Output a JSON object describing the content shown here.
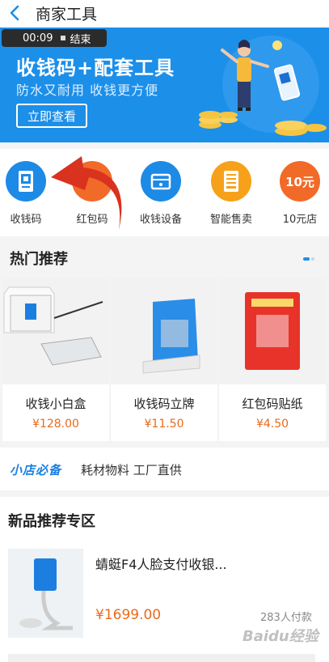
{
  "header": {
    "title": "商家工具"
  },
  "recording": {
    "time": "00:09",
    "end_label": "结束"
  },
  "banner": {
    "title": "收钱码+配套工具",
    "subtitle": "防水又耐用   收钱更方便",
    "button_label": "立即查看"
  },
  "icons": [
    {
      "label": "收钱码",
      "icon": "qr-code-icon",
      "color": "#1d8ae6"
    },
    {
      "label": "红包码",
      "icon": "red-packet-icon",
      "color": "#f26a28"
    },
    {
      "label": "收钱设备",
      "icon": "device-box-icon",
      "color": "#1d8ae6"
    },
    {
      "label": "智能售卖",
      "icon": "vending-icon",
      "color": "#f7a11a"
    },
    {
      "label": "10元店",
      "icon": "ten-yuan-icon",
      "color": "#f26a28",
      "badge": "10元"
    }
  ],
  "hot": {
    "title": "热门推荐",
    "items": [
      {
        "name": "收钱小白盒",
        "price": "¥128.00"
      },
      {
        "name": "收钱码立牌",
        "price": "¥11.50"
      },
      {
        "name": "红包码贴纸",
        "price": "¥4.50"
      }
    ]
  },
  "strip": {
    "logo": "小店必备",
    "text": "耗材物料 工厂直供"
  },
  "new_products": {
    "title": "新品推荐专区",
    "item": {
      "name": "蜻蜓F4人脸支付收银...",
      "price": "¥1699.00",
      "paid": "283人付款"
    }
  },
  "watermark": "Baidu经验",
  "colors": {
    "accent_blue": "#1c8fe9",
    "price_orange": "#e96a1a",
    "arrow_red": "#d9321f"
  }
}
